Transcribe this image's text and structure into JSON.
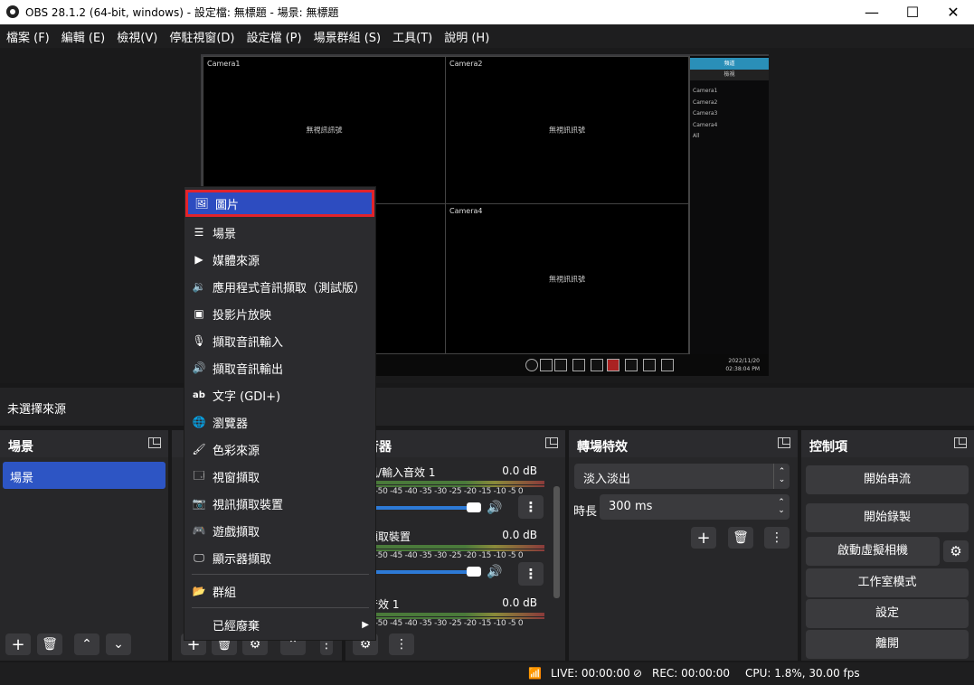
{
  "window": {
    "title": "OBS 28.1.2 (64-bit, windows) - 設定檔: 無標題 - 場景: 無標題",
    "minimize": "—",
    "maximize": "☐",
    "close": "✕"
  },
  "menubar": [
    "檔案 (F)",
    "編輯 (E)",
    "檢視(V)",
    "停駐視窗(D)",
    "設定檔 (P)",
    "場景群組 (S)",
    "工具(T)",
    "說明 (H)"
  ],
  "preview": {
    "cameras": [
      {
        "name": "Camera1",
        "signal": "無視訊訊號"
      },
      {
        "name": "Camera2",
        "signal": "無視訊訊號"
      },
      {
        "name": "",
        "signal": ""
      },
      {
        "name": "Camera4",
        "signal": "無視訊訊號"
      }
    ],
    "side_tab_active": "頻道",
    "side_tab_other": "檢視",
    "channel_list": [
      "Camera1",
      "Camera2",
      "Camera3",
      "Camera4",
      "All"
    ],
    "date": "2022/11/20",
    "time": "02:38:04 PM"
  },
  "no_source_label": "未選擇來源",
  "docks": {
    "scenes": {
      "title": "場景",
      "items": [
        "場景"
      ]
    },
    "mixer": {
      "title": "混音器",
      "channels": [
        {
          "name": "麥克風/輸入音效 1",
          "db": "0.0 dB"
        },
        {
          "name": "視訊擷取裝置",
          "db": "0.0 dB"
        },
        {
          "name": "桌面音效 1",
          "db": "0.0 dB"
        }
      ],
      "scale": "-60 -55 -50 -45 -40 -35 -30 -25 -20 -15 -10 -5 0"
    },
    "transitions": {
      "title": "轉場特效",
      "selected": "淡入淡出",
      "duration_label": "時長",
      "duration_value": "300 ms"
    },
    "controls": {
      "title": "控制項",
      "buttons": [
        "開始串流",
        "開始錄製",
        "啟動虛擬相機",
        "工作室模式",
        "設定",
        "離開"
      ]
    }
  },
  "context_menu": {
    "items": [
      {
        "label": "圖片",
        "icon": "image-icon",
        "selected": true
      },
      {
        "label": "場景",
        "icon": "list-icon"
      },
      {
        "label": "媒體來源",
        "icon": "play-icon"
      },
      {
        "label": "應用程式音訊擷取（測試版）",
        "icon": "app-audio-icon"
      },
      {
        "label": "投影片放映",
        "icon": "slideshow-icon"
      },
      {
        "label": "擷取音訊輸入",
        "icon": "microphone-icon"
      },
      {
        "label": "擷取音訊輸出",
        "icon": "speaker-icon"
      },
      {
        "label": "文字 (GDI+)",
        "icon": "text-icon"
      },
      {
        "label": "瀏覽器",
        "icon": "globe-icon"
      },
      {
        "label": "色彩來源",
        "icon": "brush-icon"
      },
      {
        "label": "視窗擷取",
        "icon": "window-icon"
      },
      {
        "label": "視訊擷取裝置",
        "icon": "camera-icon"
      },
      {
        "label": "遊戲擷取",
        "icon": "gamepad-icon"
      },
      {
        "label": "顯示器擷取",
        "icon": "monitor-icon"
      },
      {
        "label": "群組",
        "icon": "folder-icon"
      },
      {
        "label": "已經廢棄",
        "icon": ""
      }
    ]
  },
  "status": {
    "live": "LIVE: 00:00:00",
    "rec": "REC: 00:00:00",
    "cpu": "CPU: 1.8%, 30.00 fps"
  }
}
